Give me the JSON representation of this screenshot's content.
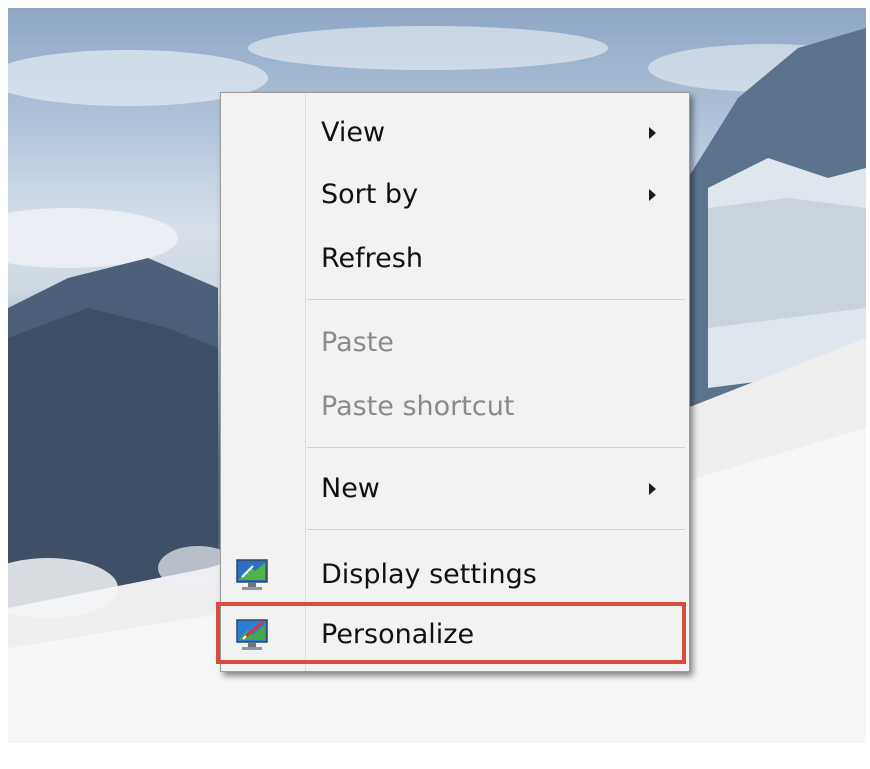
{
  "context_menu": {
    "items": [
      {
        "label": "View",
        "has_submenu": true,
        "enabled": true,
        "icon": null
      },
      {
        "label": "Sort by",
        "has_submenu": true,
        "enabled": true,
        "icon": null
      },
      {
        "label": "Refresh",
        "has_submenu": false,
        "enabled": true,
        "icon": null
      },
      {
        "label": "Paste",
        "has_submenu": false,
        "enabled": false,
        "icon": null
      },
      {
        "label": "Paste shortcut",
        "has_submenu": false,
        "enabled": false,
        "icon": null
      },
      {
        "label": "New",
        "has_submenu": true,
        "enabled": true,
        "icon": null
      },
      {
        "label": "Display settings",
        "has_submenu": false,
        "enabled": true,
        "icon": "display-settings-icon"
      },
      {
        "label": "Personalize",
        "has_submenu": false,
        "enabled": true,
        "icon": "personalize-icon"
      }
    ]
  },
  "highlight": {
    "target": "Personalize",
    "color": "#d94b3b"
  },
  "colors": {
    "menu_background": "#f2f2f2",
    "disabled_text": "#8a8a8a",
    "text": "#111111"
  }
}
